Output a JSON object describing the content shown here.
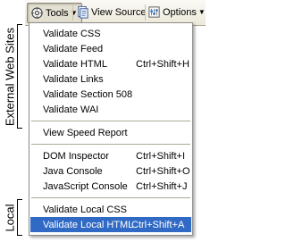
{
  "toolbar": {
    "tools_label": "Tools",
    "view_source_label": "View Source",
    "options_label": "Options"
  },
  "menu": {
    "external_items": [
      {
        "label": "Validate CSS",
        "shortcut": ""
      },
      {
        "label": "Validate Feed",
        "shortcut": ""
      },
      {
        "label": "Validate HTML",
        "shortcut": "Ctrl+Shift+H"
      },
      {
        "label": "Validate Links",
        "shortcut": ""
      },
      {
        "label": "Validate Section 508",
        "shortcut": ""
      },
      {
        "label": "Validate WAI",
        "shortcut": ""
      }
    ],
    "speed_item": {
      "label": "View Speed Report"
    },
    "dev_items": [
      {
        "label": "DOM Inspector",
        "shortcut": "Ctrl+Shift+I"
      },
      {
        "label": "Java Console",
        "shortcut": "Ctrl+Shift+O"
      },
      {
        "label": "JavaScript Console",
        "shortcut": "Ctrl+Shift+J"
      }
    ],
    "local_items": [
      {
        "label": "Validate Local CSS",
        "shortcut": ""
      },
      {
        "label": "Validate Local HTML",
        "shortcut": "Ctrl+Shift+A"
      }
    ]
  },
  "annotations": {
    "external_label": "External Web Sites",
    "local_label": "Local"
  },
  "colors": {
    "highlight": "#316ac5",
    "toolbar_bg": "#ece9d8"
  },
  "icons": {
    "tools": "gear-icon",
    "view_source": "document-icon",
    "options": "options-icon"
  }
}
